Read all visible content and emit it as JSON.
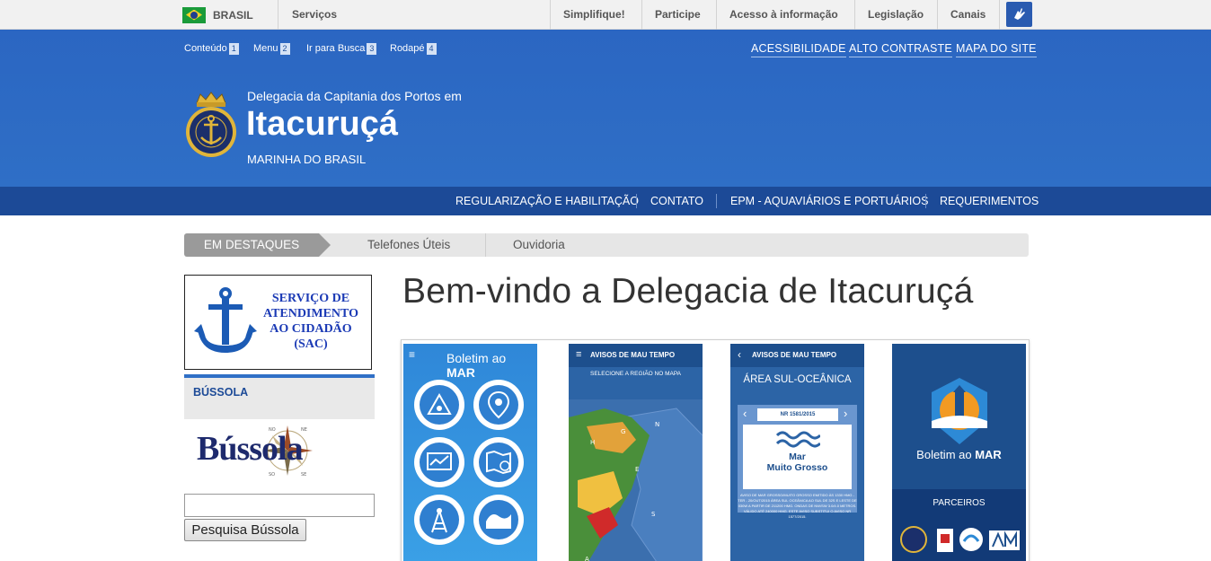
{
  "gov_bar": {
    "brasil": "BRASIL",
    "servicos": "Serviços",
    "links": [
      "Simplifique!",
      "Participe",
      "Acesso à informação",
      "Legislação",
      "Canais"
    ]
  },
  "header": {
    "skip_links": [
      {
        "label": "Conteúdo",
        "num": "1"
      },
      {
        "label": "Menu",
        "num": "2"
      },
      {
        "label": "Ir para Busca",
        "num": "3"
      },
      {
        "label": "Rodapé",
        "num": "4"
      }
    ],
    "accessibility_links": [
      "ACESSIBILIDADE",
      "ALTO CONTRASTE",
      "MAPA DO SITE"
    ],
    "org_pre": "Delegacia da Capitania dos Portos em",
    "org_name": "Itacuruçá",
    "org_sub": "MARINHA DO BRASIL"
  },
  "menu": [
    "REGULARIZAÇÃO E HABILITAÇÃO",
    "CONTATO",
    "EPM - AQUAVIÁRIOS E PORTUÁRIOS",
    "REQUERIMENTOS"
  ],
  "tabs": [
    "EM DESTAQUES",
    "Telefones Úteis",
    "Ouvidoria"
  ],
  "sidebar": {
    "sac_text": "SERVIÇO DE ATENDIMENTO AO CIDADÃO (SAC)",
    "bussola_heading": "BÚSSOLA",
    "bussola_logo_text": "Bússola",
    "search_button": "Pesquisa Bússola",
    "search_value": ""
  },
  "main": {
    "welcome": "Bem-vindo a Delegacia de Itacuruçá",
    "carousel": {
      "p1_title_a": "Boletim ao ",
      "p1_title_b": "MAR",
      "p2_head": "AVISOS DE MAU TEMPO",
      "p2_sub": "SELECIONE A REGIÃO NO MAPA",
      "p3_head": "AVISOS DE MAU TEMPO",
      "p3_area": "ÁREA SUL-OCEÂNICA",
      "p3_nr": "NR 1581/2015",
      "p3_mar": "Mar",
      "p3_mar2": "Muito Grosso",
      "p3_text": "AVISO DE MAR GROSSO/MUITO GROSSO EMITIDO ÀS 1330 HMG - TER - 20/OUT/2015 ÁREA SUL OCEÂNICA AO SUL DE 32S E LESTE DE 030W A PARTIR DE 211200 HMG. ONDAS DE NW/SW 3.0/4.0 METROS. VÁLIDO ATÉ 240000 HMG. ESTE AVISO SUBSTITUI O AVISO NR 1577/2015.",
      "p4_title_a": "Boletim ao ",
      "p4_title_b": "MAR",
      "p4_parceiros": "PARCEIROS"
    }
  },
  "colors": {
    "header_blue": "#2f6fc6",
    "menu_blue": "#1c4a97",
    "tab_active": "#9a9a9a"
  }
}
